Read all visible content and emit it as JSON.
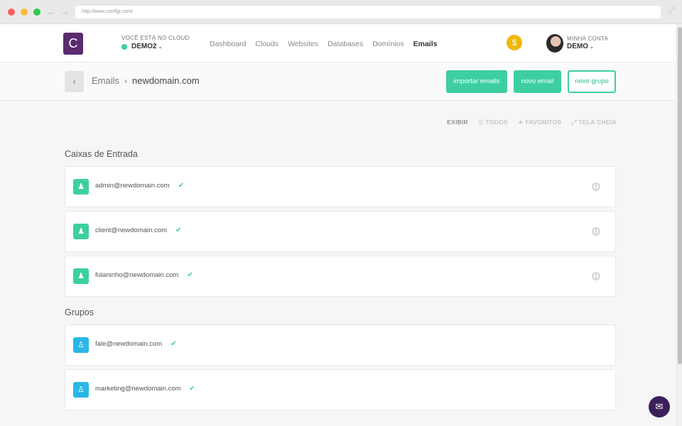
{
  "browser": {
    "url": "http://www.configr.com/",
    "back_icon": "arrow-left-icon",
    "forward_icon": "arrow-right-icon"
  },
  "header": {
    "logo_letter": "C",
    "cloud_label": "VOCÊ ESTÁ NO CLOUD",
    "cloud_name": "DEMO2",
    "nav": [
      "Dashboard",
      "Clouds",
      "Websites",
      "Databases",
      "Domínios",
      "Emails"
    ],
    "active_nav": "Emails",
    "coin_symbol": "$",
    "account_label": "MINHA CONTA",
    "account_name": "DEMO"
  },
  "page": {
    "breadcrumb_parent": "Emails",
    "breadcrumb_current": "newdomain.com",
    "buttons": {
      "import": "importar emails",
      "new_email": "novo email",
      "new_group": "novo grupo"
    }
  },
  "filters": {
    "label": "EXIBIR",
    "all": "TODOS",
    "favorites": "FAVORITOS",
    "fullscreen": "TELA CHEIA"
  },
  "inboxes": {
    "title": "Caixas de Entrada",
    "items": [
      "admin@newdomain.com",
      "client@newdomain.com",
      "fulaninho@newdomain.com"
    ]
  },
  "groups": {
    "title": "Grupos",
    "items": [
      "fale@newdomain.com",
      "marketing@newdomain.com"
    ]
  },
  "colors": {
    "accent": "#3dcfa1",
    "group_icon": "#2bb7e6",
    "logo": "#5a2b6e",
    "coin": "#f2b705",
    "chat": "#3b1f5a"
  }
}
